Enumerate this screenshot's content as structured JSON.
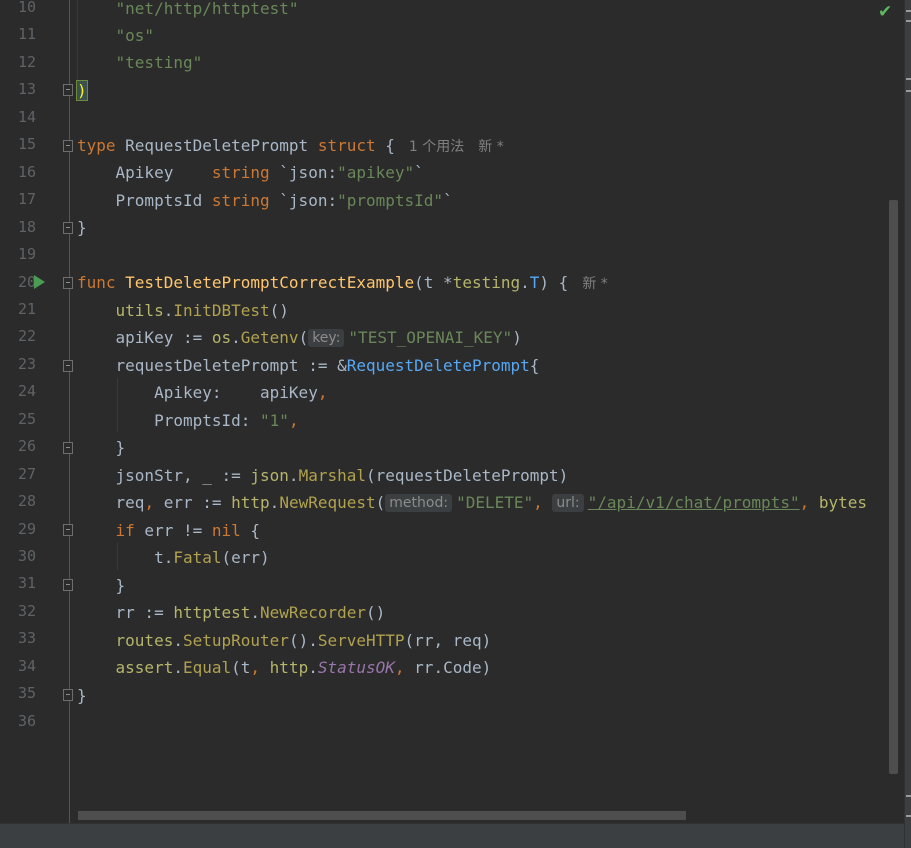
{
  "editor": {
    "line_numbers": [
      "10",
      "11",
      "12",
      "13",
      "14",
      "15",
      "16",
      "17",
      "18",
      "19",
      "20",
      "21",
      "22",
      "23",
      "24",
      "25",
      "26",
      "27",
      "28",
      "29",
      "30",
      "31",
      "32",
      "33",
      "34",
      "35",
      "36"
    ],
    "hints": {
      "usages_15": "1 个用法",
      "new_15": "新 *",
      "new_20": "新 *",
      "key": "key:",
      "method": "method:",
      "url": "url:"
    },
    "tokens": {
      "l10": "\"net/http/httptest\"",
      "l11": "\"os\"",
      "l12": "\"testing\"",
      "l13": ")",
      "l15_kw": "type",
      "l15_name": " RequestDeletePrompt ",
      "l15_struct": "struct",
      "l15_brace": " {",
      "l16_field": "Apikey    ",
      "l16_type": "string",
      "l16_tag1": " `json:",
      "l16_tag2": "\"apikey\"",
      "l16_tag3": "`",
      "l17_field": "PromptsId ",
      "l17_type": "string",
      "l17_tag1": " `json:",
      "l17_tag2": "\"promptsId\"",
      "l17_tag3": "`",
      "l18": "}",
      "l20_kw": "func",
      "l20_name": " TestDeletePromptCorrectExample",
      "l20_args1": "(t *",
      "l20_pkg": "testing",
      "l20_dot": ".",
      "l20_T": "T",
      "l20_rest": ") {",
      "l21_pkg": "utils",
      "l21_dot": ".",
      "l21_fn": "InitDBTest",
      "l21_rest": "()",
      "l22_var": "apiKey := ",
      "l22_pkg": "os",
      "l22_dot": ".",
      "l22_fn": "Getenv",
      "l22_open": "(",
      "l22_str": "\"TEST_OPENAI_KEY\"",
      "l22_close": ")",
      "l23_var": "requestDeletePrompt := &",
      "l23_type": "RequestDeletePrompt",
      "l23_brace": "{",
      "l24_field": "Apikey:    apiKey",
      "l24_comma": ",",
      "l25_field": "PromptsId: ",
      "l25_str": "\"1\"",
      "l25_comma": ",",
      "l26": "}",
      "l27_var": "jsonStr, _ := ",
      "l27_pkg": "json",
      "l27_dot": ".",
      "l27_fn": "Marshal",
      "l27_rest": "(requestDeletePrompt)",
      "l28_var": "req",
      "l28_comma": ", ",
      "l28_var2": "err := ",
      "l28_pkg": "http",
      "l28_dot": ".",
      "l28_fn": "NewRequest",
      "l28_open": "(",
      "l28_str1": "\"DELETE\"",
      "l28_comma2": ", ",
      "l28_str2": "\"/api/v1/chat/prompts\"",
      "l28_comma3": ", ",
      "l28_rest": "bytes",
      "l29_kw": "if",
      "l29_mid": " err != ",
      "l29_nil": "nil",
      "l29_brace": " {",
      "l30_var": "t.",
      "l30_fn": "Fatal",
      "l30_rest": "(err)",
      "l31": "}",
      "l32_var": "rr := ",
      "l32_pkg": "httptest",
      "l32_dot": ".",
      "l32_fn": "NewRecorder",
      "l32_rest": "()",
      "l33_pkg": "routes",
      "l33_dot": ".",
      "l33_fn": "SetupRouter",
      "l33_mid": "().",
      "l33_fn2": "ServeHTTP",
      "l33_rest": "(rr, req)",
      "l34_pkg": "assert",
      "l34_dot": ".",
      "l34_fn": "Equal",
      "l34_open": "(t",
      "l34_comma": ", ",
      "l34_pkg2": "http",
      "l34_dot2": ".",
      "l34_const": "StatusOK",
      "l34_comma2": ", ",
      "l34_rest": "rr.Code)",
      "l35": "}"
    }
  },
  "icons": {
    "run": "run-icon",
    "check": "check-icon"
  },
  "colors": {
    "background": "#2b2b2b",
    "keyword": "#cc7832",
    "string": "#6a8759",
    "function": "#ffc66d",
    "run_green": "#499c54"
  }
}
